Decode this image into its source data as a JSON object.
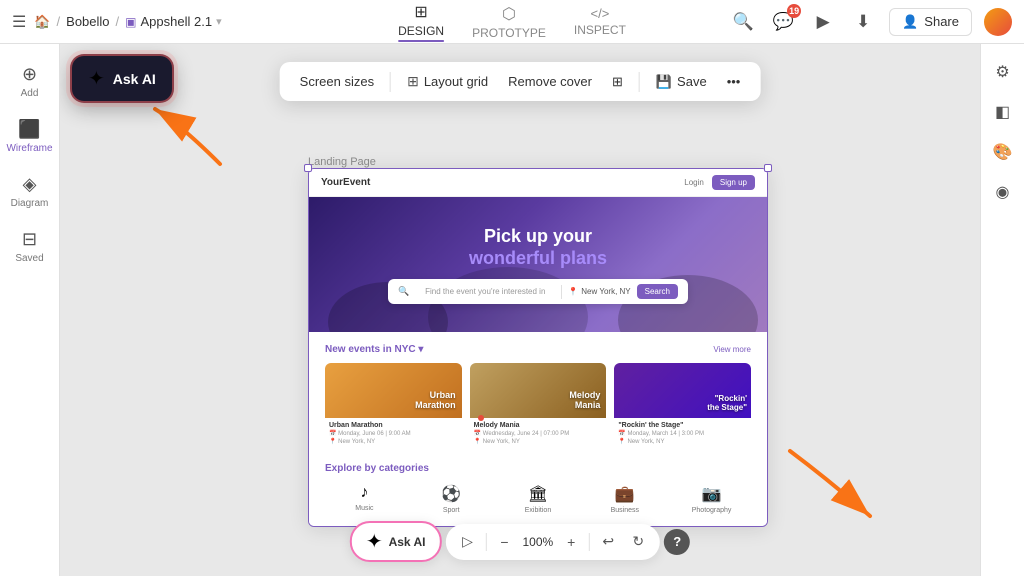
{
  "topbar": {
    "hamburger": "☰",
    "home_icon": "🏠",
    "project": "Bobello",
    "sep": "/",
    "file_icon": "⬜",
    "file_name": "Appshell 2.1",
    "chevron": "▾",
    "tabs": [
      {
        "id": "design",
        "label": "DESIGN",
        "icon": "⊞",
        "active": true
      },
      {
        "id": "prototype",
        "label": "PROTOTYPE",
        "icon": "⬡"
      },
      {
        "id": "inspect",
        "label": "INSPECT",
        "icon": "< >"
      }
    ],
    "search_icon": "🔍",
    "notifications_icon": "💬",
    "notification_count": "19",
    "play_icon": "▶",
    "download_icon": "⬇",
    "share_label": "Share",
    "person_icon": "👤"
  },
  "left_sidebar": {
    "items": [
      {
        "id": "add",
        "icon": "⊕",
        "label": "Add"
      },
      {
        "id": "wireframe",
        "icon": "⬛",
        "label": "Wireframe"
      },
      {
        "id": "diagram",
        "icon": "◈",
        "label": "Diagram"
      },
      {
        "id": "saved",
        "icon": "⊟",
        "label": "Saved"
      }
    ]
  },
  "right_sidebar": {
    "icons": [
      {
        "id": "settings",
        "icon": "⚙"
      },
      {
        "id": "layers",
        "icon": "◧"
      },
      {
        "id": "palette",
        "icon": "🎨"
      },
      {
        "id": "assets",
        "icon": "◉"
      }
    ]
  },
  "toolbar": {
    "screen_sizes_label": "Screen sizes",
    "layout_grid_icon": "⊞",
    "layout_grid_label": "Layout grid",
    "remove_cover_label": "Remove cover",
    "checkerboard_icon": "⊞",
    "save_label": "Save",
    "more_label": "•••"
  },
  "frame": {
    "label": "Landing Page"
  },
  "ask_ai_top": {
    "label": "Ask AI",
    "icon": "✦"
  },
  "ask_ai_bottom": {
    "label": "Ask AI",
    "icon": "✦"
  },
  "landing_page": {
    "logo": "YourEvent",
    "nav": [
      "Login",
      "Sign up"
    ],
    "hero_title": "Pick up your",
    "hero_subtitle": "wonderful plans",
    "search_placeholder": "Find the event you're interested in",
    "search_location": "New York, NY",
    "search_btn": "Search",
    "section_new_events": "New events in",
    "section_city": "NYC",
    "view_more": "View more",
    "cards": [
      {
        "id": "urban",
        "title": "Urban\nMarathon",
        "type": "urban"
      },
      {
        "id": "melody",
        "title": "Melody\nMania",
        "type": "melody"
      },
      {
        "id": "rockin",
        "title": "\"Rockin'\nthe Stage\"",
        "type": "rockin"
      }
    ],
    "explore_title": "Explore by",
    "explore_highlight": "categories",
    "categories": [
      {
        "id": "music",
        "icon": "♪",
        "label": "Music"
      },
      {
        "id": "sport",
        "icon": "⚽",
        "label": "Sport"
      },
      {
        "id": "exhibition",
        "icon": "🏛",
        "label": "Exibition"
      },
      {
        "id": "business",
        "icon": "💼",
        "label": "Business"
      },
      {
        "id": "photography",
        "icon": "📷",
        "label": "Photography"
      }
    ]
  },
  "bottom_bar": {
    "cursor_icon": "▷",
    "minus_icon": "−",
    "zoom_label": "100%",
    "plus_icon": "+",
    "undo_icon": "↩",
    "redo_icon": "↻",
    "help_label": "?"
  }
}
